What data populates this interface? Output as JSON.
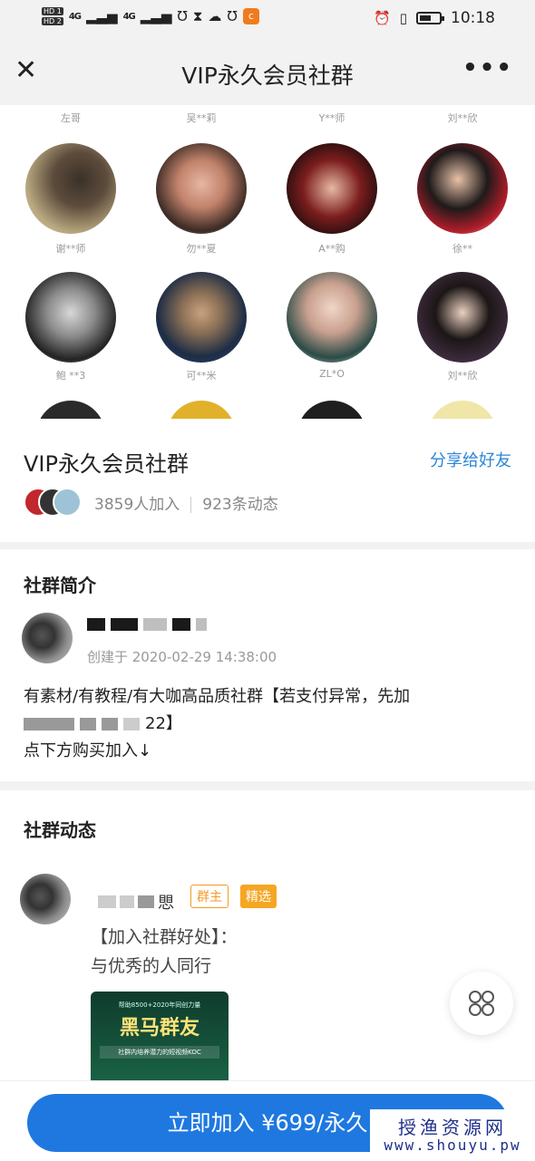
{
  "status_bar": {
    "sim1": "HD 1",
    "sim2": "HD 2",
    "signal1": "4G",
    "signal2": "4G",
    "time": "10:18"
  },
  "nav": {
    "title": "VIP永久会员社群",
    "close_icon": "close-icon",
    "more_label": "•••"
  },
  "members": {
    "top_names": [
      "左哥",
      "吴**莉",
      "Y**师",
      "刘**欣"
    ],
    "row1_names": [
      "谢**师",
      "勿**夏",
      "A**购",
      "徐**"
    ],
    "row2_names": [
      "鲍 **3",
      "可**米",
      "ZL*O",
      "刘**欣"
    ]
  },
  "group": {
    "title": "VIP永久会员社群",
    "share_label": "分享给好友",
    "joined": "3859人加入",
    "posts": "923条动态"
  },
  "intro": {
    "section_title": "社群简介",
    "created": "创建于 2020-02-29 14:38:00",
    "desc_line1": "有素材/有教程/有大咖高品质社群【若支付异常，先加",
    "desc_line2_tail": "22】",
    "desc_line3": "点下方购买加入↓"
  },
  "feed": {
    "section_title": "社群动态",
    "author_tail": "愳",
    "tag_owner": "群主",
    "tag_pick": "精选",
    "text_line1": "【加入社群好处】：",
    "text_line2": "与优秀的人同行",
    "poster_top": "帮助8500+2020年同创力量",
    "poster_title": "黑马群友",
    "poster_sub": "社群内培养潜力的短视频KOC"
  },
  "bottom": {
    "join_label": "立即加入 ¥699/永久"
  },
  "watermark": {
    "cn": "授渔资源网",
    "url": "www.shouyu.pw"
  },
  "colors": {
    "accent": "#1e78e0",
    "share": "#2c86d8",
    "tag": "#f5a623"
  }
}
